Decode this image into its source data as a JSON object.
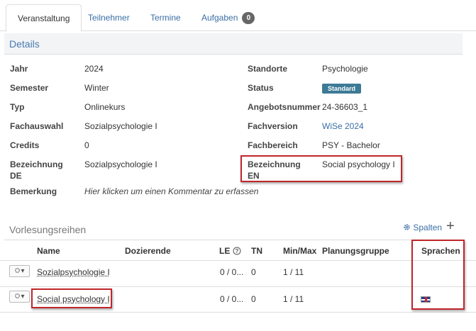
{
  "tabs": [
    {
      "label": "Veranstaltung"
    },
    {
      "label": "Teilnehmer"
    },
    {
      "label": "Termine"
    },
    {
      "label": "Aufgaben",
      "badge": "0"
    }
  ],
  "details": {
    "title": "Details",
    "left": [
      {
        "label": "Jahr",
        "value": "2024"
      },
      {
        "label": "Semester",
        "value": "Winter"
      },
      {
        "label": "Typ",
        "value": "Onlinekurs"
      },
      {
        "label": "Fachauswahl",
        "value": "Sozialpsychologie I"
      },
      {
        "label": "Credits",
        "value": "0"
      },
      {
        "label1": "Bezeichnung",
        "label2": "DE",
        "value": "Sozialpsychologie I"
      },
      {
        "label": "Bemerkung",
        "value": "Hier klicken um einen Kommentar zu erfassen"
      }
    ],
    "right": [
      {
        "label": "Standorte",
        "value": "Psychologie"
      },
      {
        "label": "Status",
        "value": "Standard"
      },
      {
        "label": "Angebotsnummer",
        "value": "24-36603_1"
      },
      {
        "label": "Fachversion",
        "value": "WiSe 2024"
      },
      {
        "label": "Fachbereich",
        "value": "PSY - Bachelor"
      },
      {
        "label1": "Bezeichnung",
        "label2": "EN",
        "value": "Social psychology I"
      }
    ]
  },
  "lectures": {
    "title": "Vorlesungsreihen",
    "columns_label": "Spalten",
    "headers": [
      "Name",
      "Dozierende",
      "LE",
      "TN",
      "Min/Max",
      "Planungsgruppe",
      "Sprachen"
    ],
    "rows": [
      {
        "name": "Sozialpsychologie I",
        "le": "0 / 0...",
        "tn": "0",
        "minmax": "1 / 11"
      },
      {
        "name": "Social psychology I",
        "le": "0 / 0...",
        "tn": "0",
        "minmax": "1 / 11"
      }
    ]
  },
  "colors": {
    "accent": "#3a6ea5",
    "status": "#3d7a95",
    "highlight": "#c0262c"
  },
  "icons": [
    "gear-icon",
    "plus-icon",
    "help-circle-icon",
    "caret-down-icon",
    "uk-flag-icon"
  ]
}
